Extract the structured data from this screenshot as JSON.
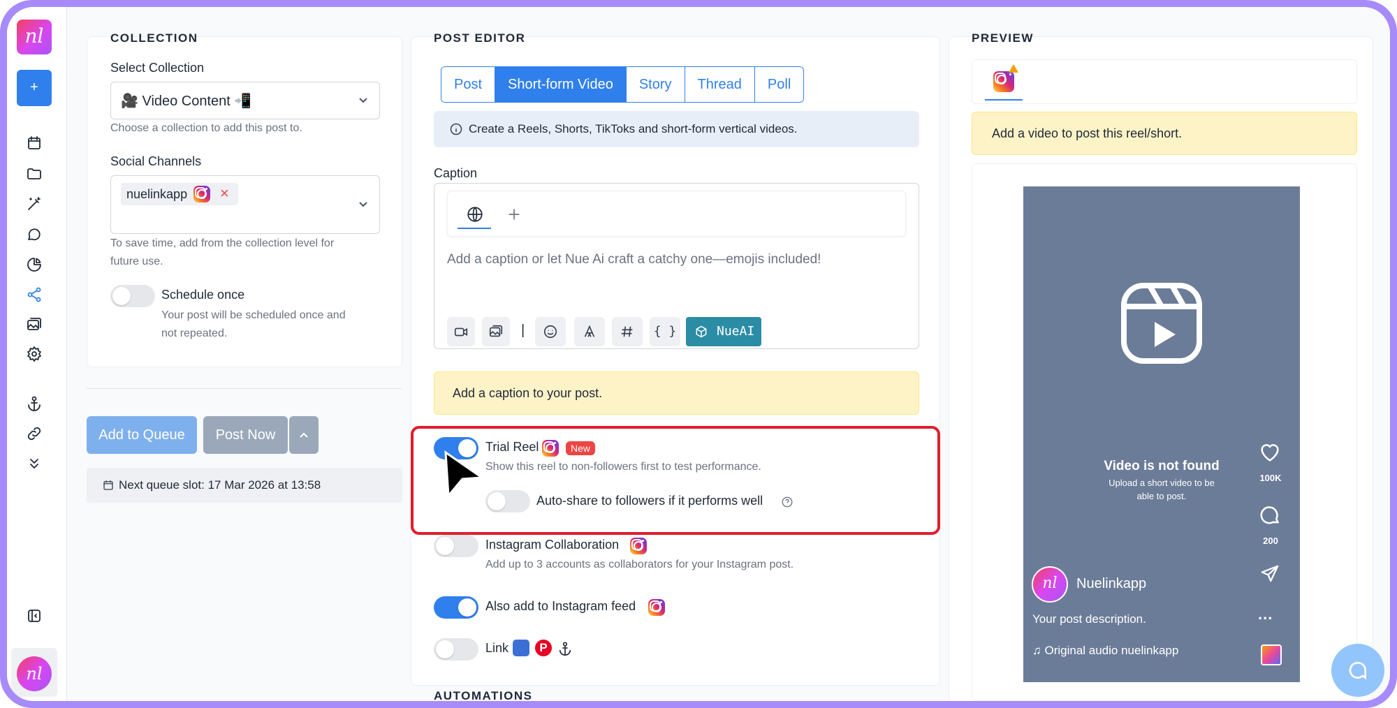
{
  "sidebar": {
    "logo": "nl",
    "add_button": "+",
    "icons": [
      "calendar-icon",
      "folder-icon",
      "magic-wand-icon",
      "chat-icon",
      "pie-chart-icon",
      "share-icon",
      "images-icon",
      "gear-icon",
      "anchor-icon",
      "link-icon",
      "chevrons-down-icon",
      "sidebar-toggle-icon"
    ],
    "avatar": "nl"
  },
  "collection": {
    "section_title": "COLLECTION",
    "select_label": "Select Collection",
    "select_value": "🎥 Video Content 📲",
    "select_hint": "Choose a collection to add this post to.",
    "channels_label": "Social Channels",
    "channel_chip": "nuelinkapp",
    "channel_remove": "×",
    "channels_hint_1": "To save time, add from the collection level for",
    "channels_hint_2": "future use.",
    "schedule_label": "Schedule once",
    "schedule_hint_1": "Your post will be scheduled once and",
    "schedule_hint_2": "not repeated."
  },
  "actions": {
    "add_to_queue": "Add to Queue",
    "post_now": "Post Now",
    "next_slot": "Next queue slot: 17 Mar 2026 at 13:58"
  },
  "editor": {
    "section_title": "POST EDITOR",
    "tabs": [
      "Post",
      "Short-form Video",
      "Story",
      "Thread",
      "Poll"
    ],
    "active_tab": "Short-form Video",
    "info_text": "Create a Reels, Shorts, TikToks and short-form vertical videos.",
    "caption_label": "Caption",
    "caption_placeholder": "Add a caption or let Nue Ai craft a catchy one—emojis included!",
    "toolbar_separator": "|",
    "nueai_label": "NueAI",
    "caption_warning": "Add a caption to your post.",
    "trial_reel_label": "Trial Reel",
    "trial_reel_badge": "New",
    "trial_reel_hint": "Show this reel to non-followers first to test performance.",
    "auto_share_label": "Auto-share to followers if it performs well",
    "collab_label": "Instagram Collaboration",
    "collab_hint": "Add up to 3 accounts as collaborators for your Instagram post.",
    "feed_label": "Also add to Instagram feed",
    "link_label": "Link",
    "automations_title": "AUTOMATIONS"
  },
  "toggles": {
    "schedule_once": false,
    "trial_reel": true,
    "auto_share": false,
    "collaboration": false,
    "instagram_feed": true,
    "link": false
  },
  "preview": {
    "section_title": "PREVIEW",
    "warning": "Add a video to post this reel/short.",
    "video_not_found": "Video is not found",
    "upload_hint_1": "Upload a short video to be",
    "upload_hint_2": "able to post.",
    "likes": "100K",
    "comments": "200",
    "username": "Nuelinkapp",
    "description": "Your post description.",
    "audio": "♫ Original audio nuelinkapp",
    "more": "..."
  },
  "colors": {
    "accent": "#2f80ed",
    "highlight_box": "#e11d2e",
    "frame": "#a78bfa",
    "preview_bg": "#6b7c98",
    "nueai": "#2b8ca6"
  }
}
